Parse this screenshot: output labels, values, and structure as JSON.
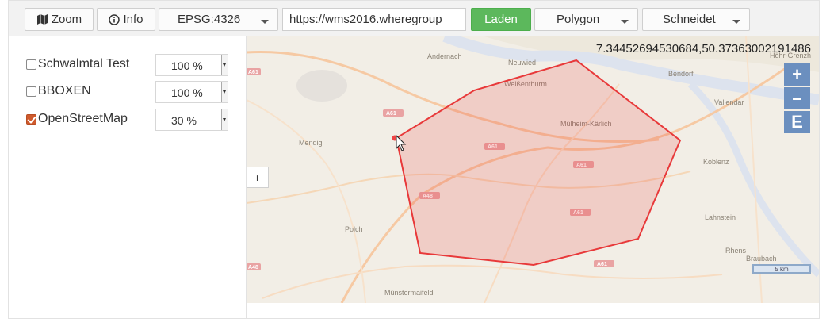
{
  "toolbar": {
    "zoom_label": "Zoom",
    "info_label": "Info",
    "crs_value": "EPSG:4326",
    "url_value": "https://wms2016.wheregroup",
    "load_label": "Laden",
    "geometry_value": "Polygon",
    "operation_value": "Schneidet"
  },
  "layers": [
    {
      "name": "Schwalmtal Test",
      "checked": false,
      "opacity": "100 %"
    },
    {
      "name": "BBOXEN",
      "checked": false,
      "opacity": "100 %"
    },
    {
      "name": "OpenStreetMap",
      "checked": true,
      "opacity": "30 %"
    }
  ],
  "map": {
    "coordinates": "7.34452694530684,50.37363002191486",
    "expand_label": "+",
    "zoom_in": "+",
    "zoom_out": "–",
    "extent": "E",
    "scale": "5 km",
    "places": [
      "Andernach",
      "Neuwied",
      "Weißenthurm",
      "Bendorf",
      "Vallendar",
      "Mülheim-Kärlich",
      "Mendig",
      "Koblenz",
      "Polch",
      "Lahnstein",
      "Rhens",
      "Braubach",
      "Münstermaifeld",
      "Höhr-Grenzh"
    ],
    "roads": [
      "A61",
      "A61",
      "A61",
      "A61",
      "A48",
      "A61",
      "A61",
      "A48"
    ],
    "polygon_color": "#e8393a"
  }
}
